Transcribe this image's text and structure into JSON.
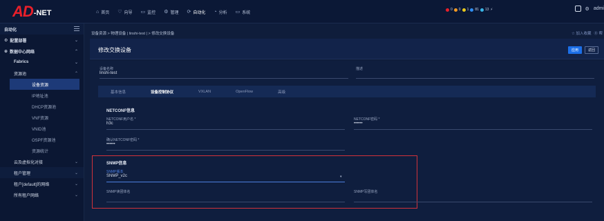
{
  "logo": {
    "ad": "AD",
    "net": "-NET"
  },
  "nav": {
    "items": [
      {
        "icon": "⌂",
        "label": "首页"
      },
      {
        "icon": "♡",
        "label": "向导"
      },
      {
        "icon": "▭",
        "label": "监控"
      },
      {
        "icon": "⚙",
        "label": "管理"
      },
      {
        "icon": "⟳",
        "label": "自动化"
      },
      {
        "icon": "◔",
        "label": "分析"
      },
      {
        "icon": "▭",
        "label": "系统"
      }
    ]
  },
  "alerts": {
    "items": [
      {
        "color": "#e8202a",
        "count": "0"
      },
      {
        "color": "#f59a23",
        "count": "0"
      },
      {
        "color": "#e8c81d",
        "count": "1"
      },
      {
        "color": "#2f8ef2",
        "count": "81"
      },
      {
        "color": "#38b4e6",
        "count": "13"
      }
    ],
    "extra_icon": "⚡"
  },
  "topright": {
    "user": "admi"
  },
  "sidebar": {
    "header": "自动化",
    "items": [
      {
        "label": "配置部署",
        "icon": "⚙"
      },
      {
        "label": "数据中心网络",
        "icon": "⊕"
      },
      {
        "label": "Fabrics"
      },
      {
        "label": "资源池"
      },
      {
        "label": "设备资源"
      },
      {
        "label": "IP地址池"
      },
      {
        "label": "DHCP资源池"
      },
      {
        "label": "VNF资源"
      },
      {
        "label": "VNID池"
      },
      {
        "label": "OSPF资源池"
      },
      {
        "label": "资源统计"
      },
      {
        "label": "云及虚拟化对接"
      },
      {
        "label": "租户管理"
      },
      {
        "label": "租户[default]的网络"
      },
      {
        "label": "所有租户网络"
      }
    ]
  },
  "main": {
    "breadcrumb": "设备资源 > 物理设备 | linshi-test | > 修改交换设备",
    "bc_right": [
      "☆ 加入收藏",
      "⓪ 帮"
    ],
    "title": "修改交换设备",
    "apply": "应用",
    "back": "返回",
    "device_name_label": "设备名称",
    "device_name_value": "linshi-test",
    "desc_label": "描述",
    "desc_value": "",
    "tabs": [
      "基本信息",
      "设备控制协议",
      "VXLAN",
      "OpenFlow",
      "高级"
    ],
    "netconf": {
      "title": "NETCONF信息",
      "user_label": "NETCONF用户名 *",
      "user_value": "h3c",
      "pwd_label": "NETCONF密码 *",
      "pwd_value": "••••••",
      "confirm_label": "确认NETCONF密码 *",
      "confirm_value": "••••••"
    },
    "snmp": {
      "title": "SNMP信息",
      "version_label": "SNMP版本",
      "version_value": "SNMP_v2c",
      "read_label": "SNMP读团体名",
      "read_value": "",
      "write_label": "SNMP写团体名",
      "write_value": ""
    }
  }
}
